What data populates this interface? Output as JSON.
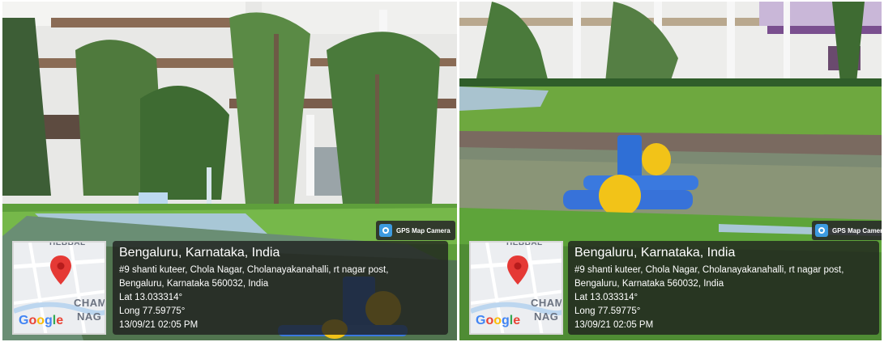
{
  "panels": [
    {
      "gps_badge": "GPS Map Camera",
      "map_labels": [
        "HEBBAL",
        "CHAM",
        "NAG"
      ],
      "google_logo": "Google",
      "location_title": "Bengaluru, Karnataka, India",
      "address_line1": "#9 shanti kuteer, Chola Nagar, Cholanayakanahalli, rt nagar post,",
      "address_line2": "Bengaluru, Karnataka 560032, India",
      "lat": "Lat 13.033314°",
      "long": "Long 77.59775°",
      "datetime": "13/09/21 02:05 PM"
    },
    {
      "gps_badge": "GPS Map Camera",
      "map_labels": [
        "HEBBAL",
        "CHAM",
        "NAG"
      ],
      "google_logo": "Google",
      "location_title": "Bengaluru, Karnataka, India",
      "address_line1": "#9 shanti kuteer, Chola Nagar, Cholanayakanahalli, rt nagar post,",
      "address_line2": "Bengaluru, Karnataka 560032, India",
      "lat": "Lat 13.033314°",
      "long": "Long 77.59775°",
      "datetime": "13/09/21 02:05 PM"
    }
  ],
  "colors": {
    "pin": "#e53935",
    "google_blue": "#4285f4",
    "google_red": "#ea4335",
    "google_yellow": "#fbbc05",
    "google_green": "#34a853",
    "aerator_blue": "#2f6fd6",
    "aerator_yellow": "#f2c318"
  }
}
